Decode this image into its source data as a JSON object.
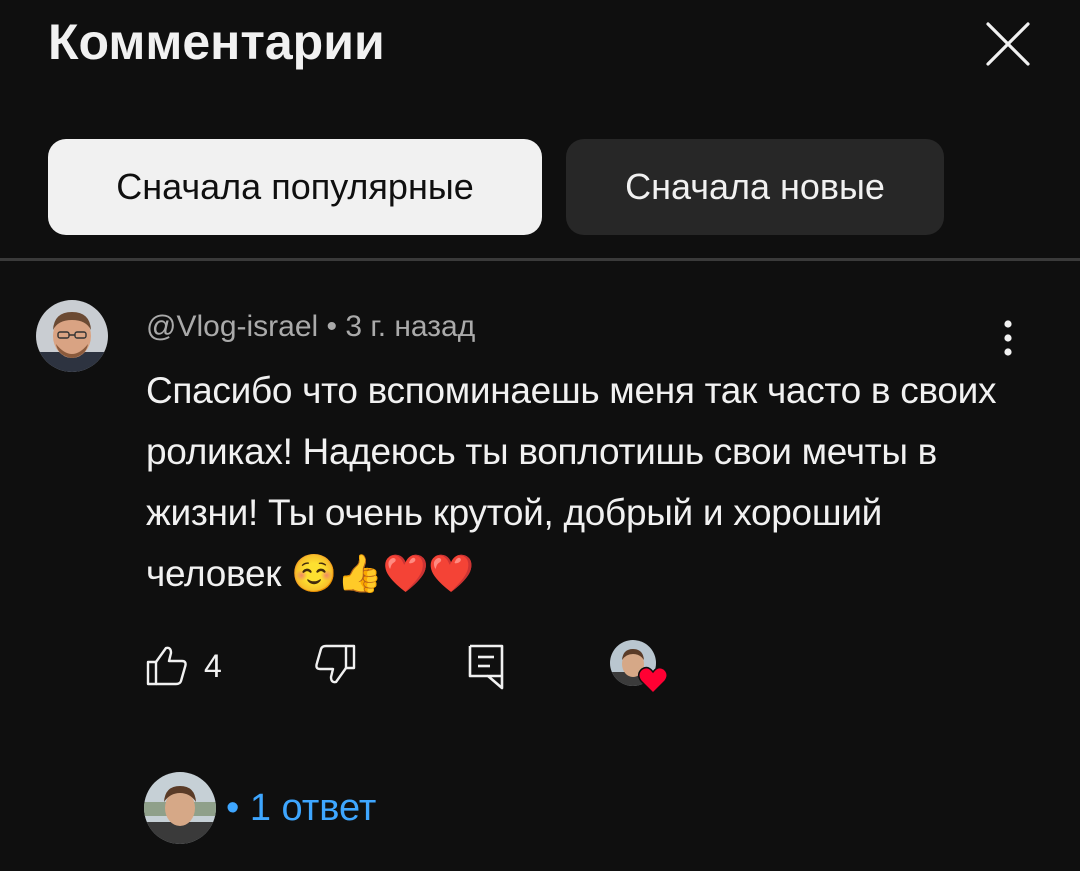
{
  "header": {
    "title": "Комментарии",
    "close_icon": "close-icon"
  },
  "sort_chips": [
    {
      "label": "Сначала популярные",
      "selected": true
    },
    {
      "label": "Сначала новые",
      "selected": false
    }
  ],
  "comment": {
    "author": "@Vlog-israel",
    "separator": "•",
    "time": "3 г. назад",
    "text": "Спасибо что вспоминаешь меня так часто в своих роликах! Надеюсь ты воплотишь свои мечты в жизни! Ты очень крутой, добрый и хороший человек ☺️👍❤️❤️",
    "like_count": "4",
    "icons": {
      "like": "thumbs-up-icon",
      "dislike": "thumbs-down-icon",
      "reply": "reply-icon",
      "menu": "more-vert-icon",
      "creator_heart": "heart-icon"
    }
  },
  "replies": {
    "label": "• 1 ответ"
  },
  "colors": {
    "background": "#0f0f0f",
    "text": "#f1f1f1",
    "secondary_text": "#aaaaaa",
    "chip_active_bg": "#f1f1f1",
    "chip_inactive_bg": "#272727",
    "link": "#3ea6ff",
    "heart": "#ff0033"
  }
}
